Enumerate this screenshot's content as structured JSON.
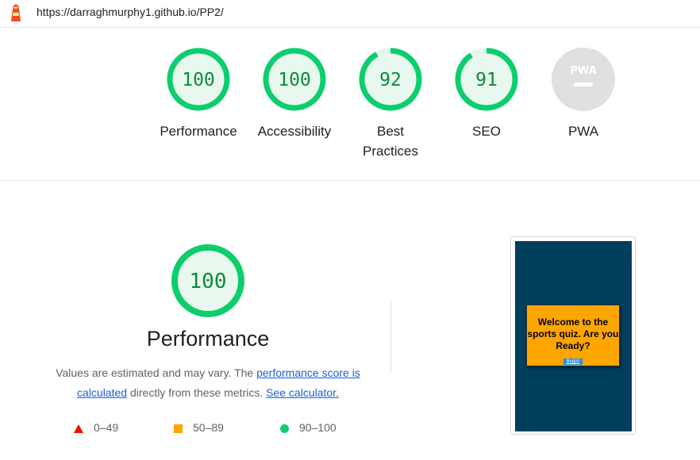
{
  "url": "https://darraghmurphy1.github.io/PP2/",
  "colors": {
    "pass_green": "#0cce6b",
    "pass_fill": "#e8f8ee",
    "pass_text": "#0c8a39",
    "pwa_gray": "#e0e0e0",
    "fail_red": "#eb0f00",
    "average_orange": "#ffa400",
    "link_blue": "#1a5fd8",
    "screenshot_bg": "#003f5c",
    "quiz_card_bg": "#ffa500"
  },
  "gauges": [
    {
      "label_line1": "Performance",
      "label_line2": "",
      "score": "100"
    },
    {
      "label_line1": "Accessibility",
      "label_line2": "",
      "score": "100"
    },
    {
      "label_line1": "Best",
      "label_line2": "Practices",
      "score": "92"
    },
    {
      "label_line1": "SEO",
      "label_line2": "",
      "score": "91"
    },
    {
      "label_line1": "PWA",
      "label_line2": "",
      "score": "PWA"
    }
  ],
  "performance": {
    "score": "100",
    "title": "Performance",
    "desc_prefix": "Values are estimated and may vary. The ",
    "desc_link1": "performance score is calculated",
    "desc_middle": " directly from these metrics. ",
    "desc_link2": "See calculator."
  },
  "legend": [
    {
      "range": "0–49",
      "shape": "triangle"
    },
    {
      "range": "50–89",
      "shape": "square"
    },
    {
      "range": "90–100",
      "shape": "circle"
    }
  ],
  "screenshot": {
    "card_text": "Welcome to the sports quiz. Are you Ready?",
    "button_label": "Begin!"
  }
}
